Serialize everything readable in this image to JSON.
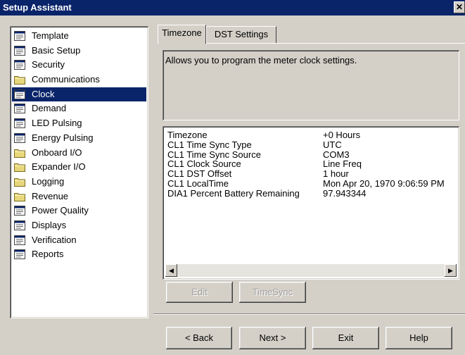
{
  "window": {
    "title": "Setup Assistant",
    "close_label": "✕"
  },
  "tree": {
    "items": [
      {
        "label": "Template",
        "icon": "document-icon"
      },
      {
        "label": "Basic Setup",
        "icon": "document-icon"
      },
      {
        "label": "Security",
        "icon": "document-icon"
      },
      {
        "label": "Communications",
        "icon": "folder-icon"
      },
      {
        "label": "Clock",
        "icon": "document-icon",
        "selected": true
      },
      {
        "label": "Demand",
        "icon": "document-icon"
      },
      {
        "label": "LED Pulsing",
        "icon": "document-icon"
      },
      {
        "label": "Energy Pulsing",
        "icon": "document-icon"
      },
      {
        "label": "Onboard I/O",
        "icon": "folder-icon"
      },
      {
        "label": "Expander I/O",
        "icon": "folder-icon"
      },
      {
        "label": "Logging",
        "icon": "folder-icon"
      },
      {
        "label": "Revenue",
        "icon": "folder-icon"
      },
      {
        "label": "Power Quality",
        "icon": "document-icon"
      },
      {
        "label": "Displays",
        "icon": "document-icon"
      },
      {
        "label": "Verification",
        "icon": "document-icon"
      },
      {
        "label": "Reports",
        "icon": "document-icon"
      }
    ]
  },
  "tabs": [
    {
      "label": "Timezone",
      "active": true
    },
    {
      "label": "DST Settings",
      "active": false
    }
  ],
  "description": "Allows you to program the meter clock settings.",
  "settings": {
    "rows": [
      {
        "name": "Timezone",
        "value": "+0 Hours"
      },
      {
        "name": "CL1 Time Sync Type",
        "value": "UTC"
      },
      {
        "name": "CL1 Time Sync Source",
        "value": "COM3"
      },
      {
        "name": "CL1 Clock Source",
        "value": "Line Freq"
      },
      {
        "name": "CL1 DST Offset",
        "value": "1 hour"
      },
      {
        "name": "CL1 LocalTime",
        "value": "Mon Apr 20, 1970 9:06:59 PM"
      },
      {
        "name": "DIA1 Percent Battery Remaining",
        "value": "97.943344"
      }
    ]
  },
  "actions": {
    "edit": "Edit",
    "timesync": "TimeSync"
  },
  "nav": {
    "back": "< Back",
    "next": "Next >",
    "exit": "Exit",
    "help": "Help"
  },
  "colors": {
    "selection": "#0a246a",
    "face": "#d4d0c8"
  }
}
